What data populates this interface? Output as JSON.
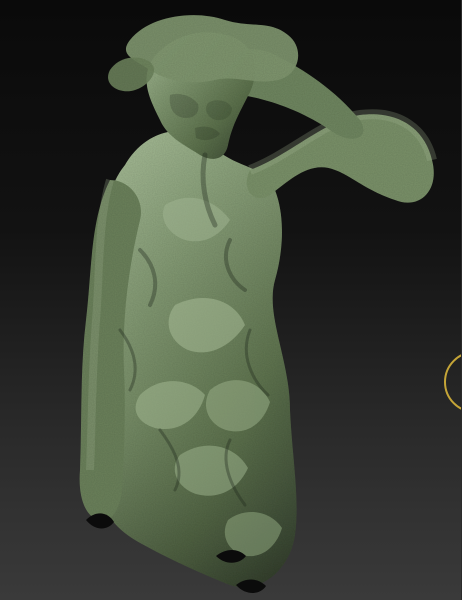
{
  "window": {
    "title": ""
  },
  "canvas": {
    "object": "green-clay-figure",
    "accent_colors": {
      "clay_dark": "#4a5a3a",
      "clay_mid": "#6f8660",
      "clay_light": "#9fb38f",
      "gizmo": "#d7b43a"
    }
  }
}
